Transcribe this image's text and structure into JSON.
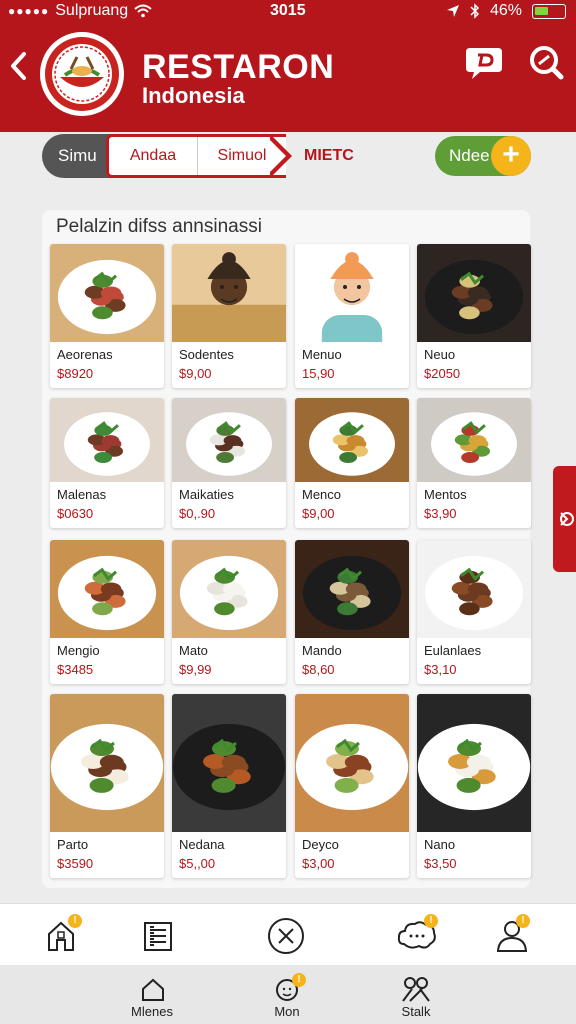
{
  "status_bar": {
    "carrier": "Sulpruang",
    "time": "3015",
    "battery": "46%",
    "battery_level": 0.46
  },
  "header": {
    "title": "RESTARON",
    "subtitle": "Indonesia"
  },
  "crumbs": {
    "first": "Simu",
    "tab1": "Andaa",
    "tab2": "Simuol",
    "current": "MIETC"
  },
  "pill": {
    "label": "Ndee",
    "plus": "+"
  },
  "menu": {
    "heading": "Pelalzin difss annsinassi",
    "items": [
      {
        "name": "Aeorenas",
        "price": "$8920"
      },
      {
        "name": "Sodentes",
        "price": "$9,00"
      },
      {
        "name": "Menuo",
        "price": "15,90"
      },
      {
        "name": "Neuo",
        "price": "$2050"
      },
      {
        "name": "Malenas",
        "price": "$0630"
      },
      {
        "name": "Maikaties",
        "price": "$0,.90"
      },
      {
        "name": "Menco",
        "price": "$9,00"
      },
      {
        "name": "Mentos",
        "price": "$3,90"
      },
      {
        "name": "Mengio",
        "price": "$3485"
      },
      {
        "name": "Mato",
        "price": "$9,99"
      },
      {
        "name": "Mando",
        "price": "$8,60"
      },
      {
        "name": "Eulanlaes",
        "price": "$3,10"
      },
      {
        "name": "Parto",
        "price": "$3590"
      },
      {
        "name": "Nedana",
        "price": "$5,,00"
      },
      {
        "name": "Deyco",
        "price": "$3,00"
      },
      {
        "name": "Nano",
        "price": "$3,50"
      }
    ]
  },
  "bottom_nav": {
    "label1": "Mlenes",
    "label2": "Mon",
    "label3": "Stalk",
    "badge": "!"
  },
  "colors": {
    "brand_red": "#b5161b",
    "accent_yellow": "#f4b41a",
    "accent_green": "#5f9d37"
  }
}
